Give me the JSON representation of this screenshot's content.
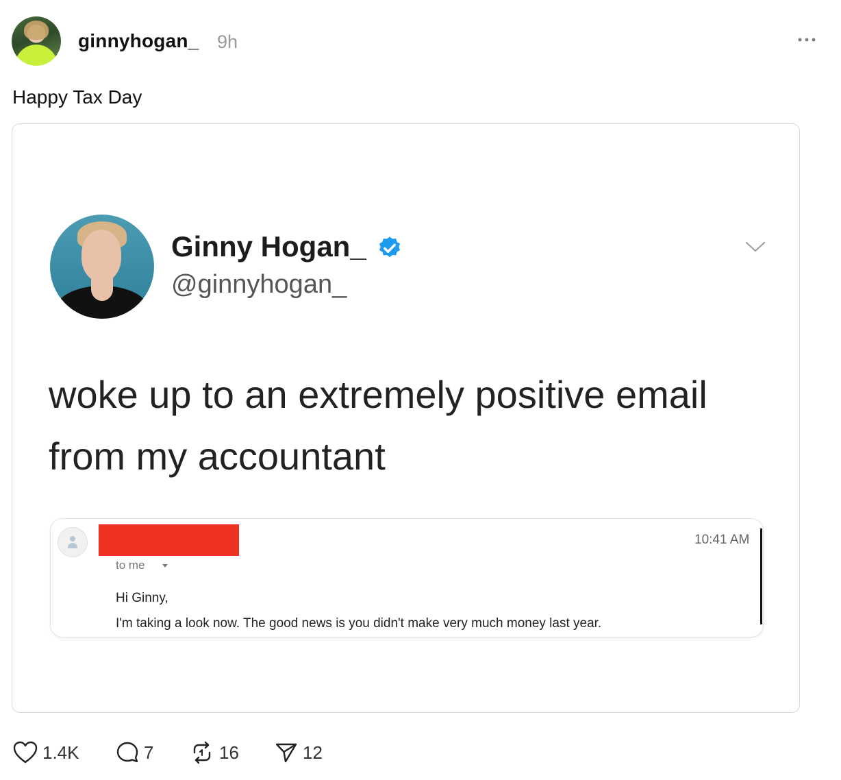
{
  "post": {
    "username": "ginnyhogan_",
    "time_ago": "9h",
    "text": "Happy Tax Day"
  },
  "embedded_tweet": {
    "display_name": "Ginny Hogan_",
    "handle": "@ginnyhogan_",
    "text": "woke up to an extremely positive email from my accountant",
    "verified_color": "#1d9bf0"
  },
  "email": {
    "time": "10:41 AM",
    "to": "to me",
    "greeting": "Hi Ginny,",
    "body": "I'm taking a look now. The good news is you didn't make very much money last year.",
    "redaction_color": "#ee3322"
  },
  "actions": {
    "likes": "1.4K",
    "replies": "7",
    "reposts": "16",
    "shares": "12"
  },
  "icons": [
    "more-icon",
    "verified-icon",
    "chevron-down-icon",
    "heart-icon",
    "comment-icon",
    "repost-icon",
    "send-icon"
  ]
}
